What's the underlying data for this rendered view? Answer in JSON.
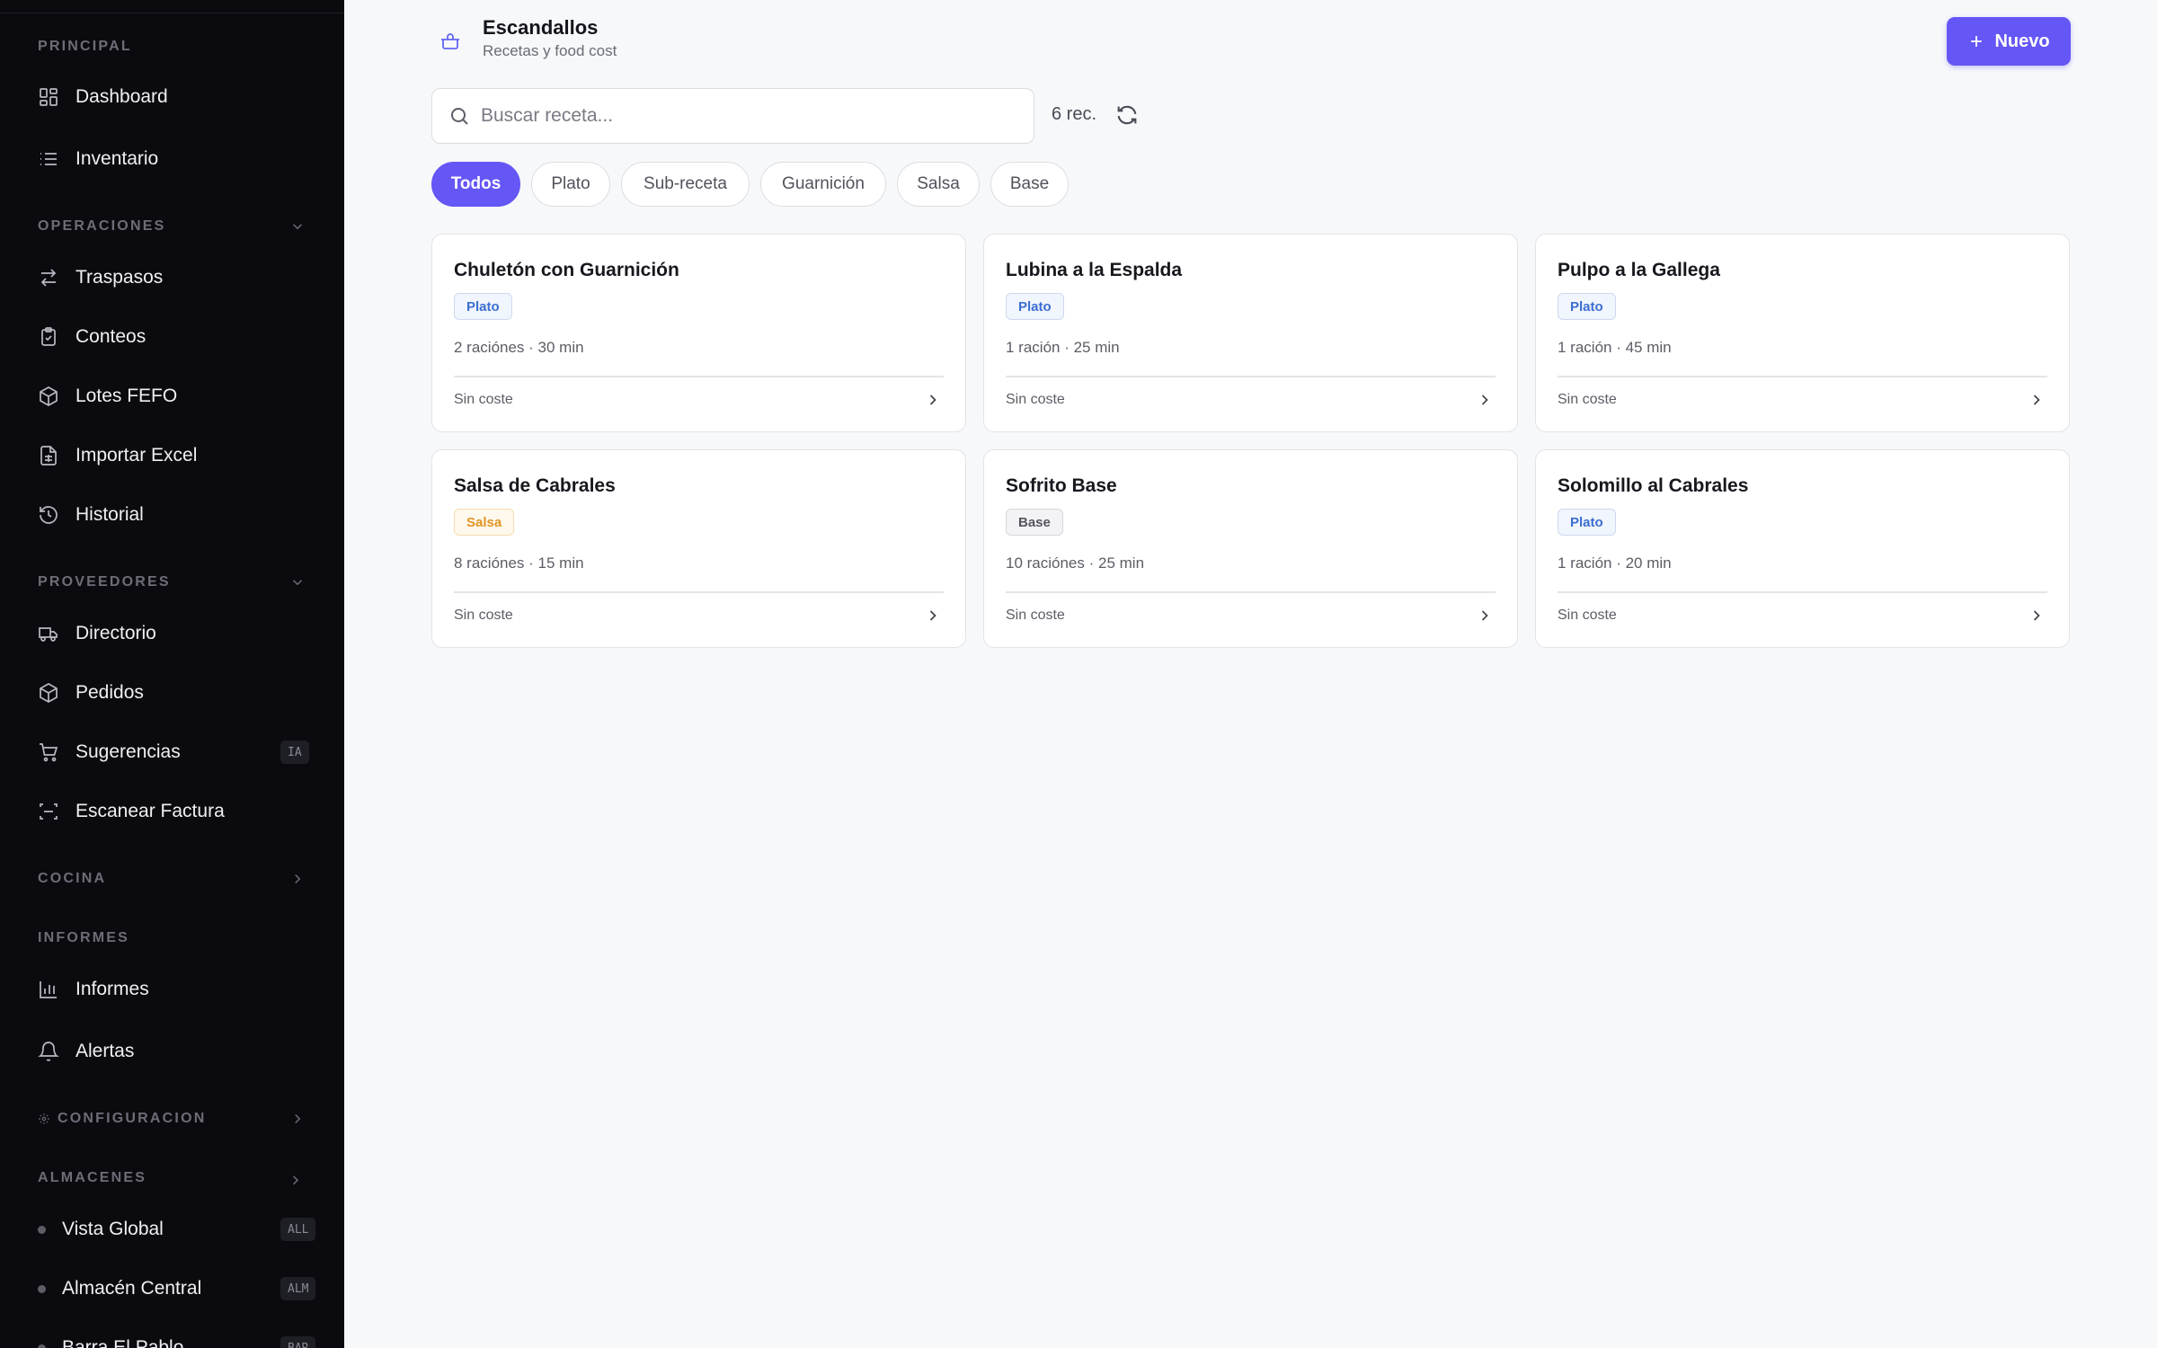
{
  "sidebar": {
    "sections": {
      "principal": "PRINCIPAL",
      "operaciones": "OPERACIONES",
      "proveedores": "PROVEEDORES",
      "cocina": "COCINA",
      "informes": "INFORMES",
      "configuracion": "CONFIGURACION",
      "almacenes": "ALMACENES"
    },
    "items": {
      "dashboard": "Dashboard",
      "inventario": "Inventario",
      "traspasos": "Traspasos",
      "conteos": "Conteos",
      "lotes": "Lotes FEFO",
      "importar": "Importar Excel",
      "historial": "Historial",
      "directorio": "Directorio",
      "pedidos": "Pedidos",
      "sugerencias": "Sugerencias",
      "sugerencias_badge": "IA",
      "escanear": "Escanear Factura",
      "informes": "Informes",
      "alertas": "Alertas"
    },
    "warehouses": [
      {
        "label": "Vista Global",
        "code": "ALL"
      },
      {
        "label": "Almacén Central",
        "code": "ALM"
      },
      {
        "label": "Barra El Pablo",
        "code": "BAR"
      }
    ]
  },
  "header": {
    "title": "Escandallos",
    "subtitle": "Recetas y food cost",
    "new_button": "Nuevo",
    "icon": "cooking-pot-icon"
  },
  "search": {
    "placeholder": "Buscar receta...",
    "value": "",
    "count": "6 rec."
  },
  "filters": [
    "Todos",
    "Plato",
    "Sub-receta",
    "Guarnición",
    "Salsa",
    "Base"
  ],
  "active_filter": "Todos",
  "recipes": [
    {
      "title": "Chuletón con Guarnición",
      "type": "Plato",
      "meta": "2 raciónes · 30 min",
      "cost": "Sin coste"
    },
    {
      "title": "Lubina a la Espalda",
      "type": "Plato",
      "meta": "1 ración · 25 min",
      "cost": "Sin coste"
    },
    {
      "title": "Pulpo a la Gallega",
      "type": "Plato",
      "meta": "1 ración · 45 min",
      "cost": "Sin coste"
    },
    {
      "title": "Salsa de Cabrales",
      "type": "Salsa",
      "meta": "8 raciónes · 15 min",
      "cost": "Sin coste"
    },
    {
      "title": "Sofrito Base",
      "type": "Base",
      "meta": "10 raciónes · 25 min",
      "cost": "Sin coste"
    },
    {
      "title": "Solomillo al Cabrales",
      "type": "Plato",
      "meta": "1 ración · 20 min",
      "cost": "Sin coste"
    }
  ],
  "colors": {
    "accent": "#6557f5",
    "sidebar_bg": "#0b0b0f",
    "badge_plato": "#3b6fd1",
    "badge_salsa": "#e09524",
    "badge_base": "#55555f"
  }
}
